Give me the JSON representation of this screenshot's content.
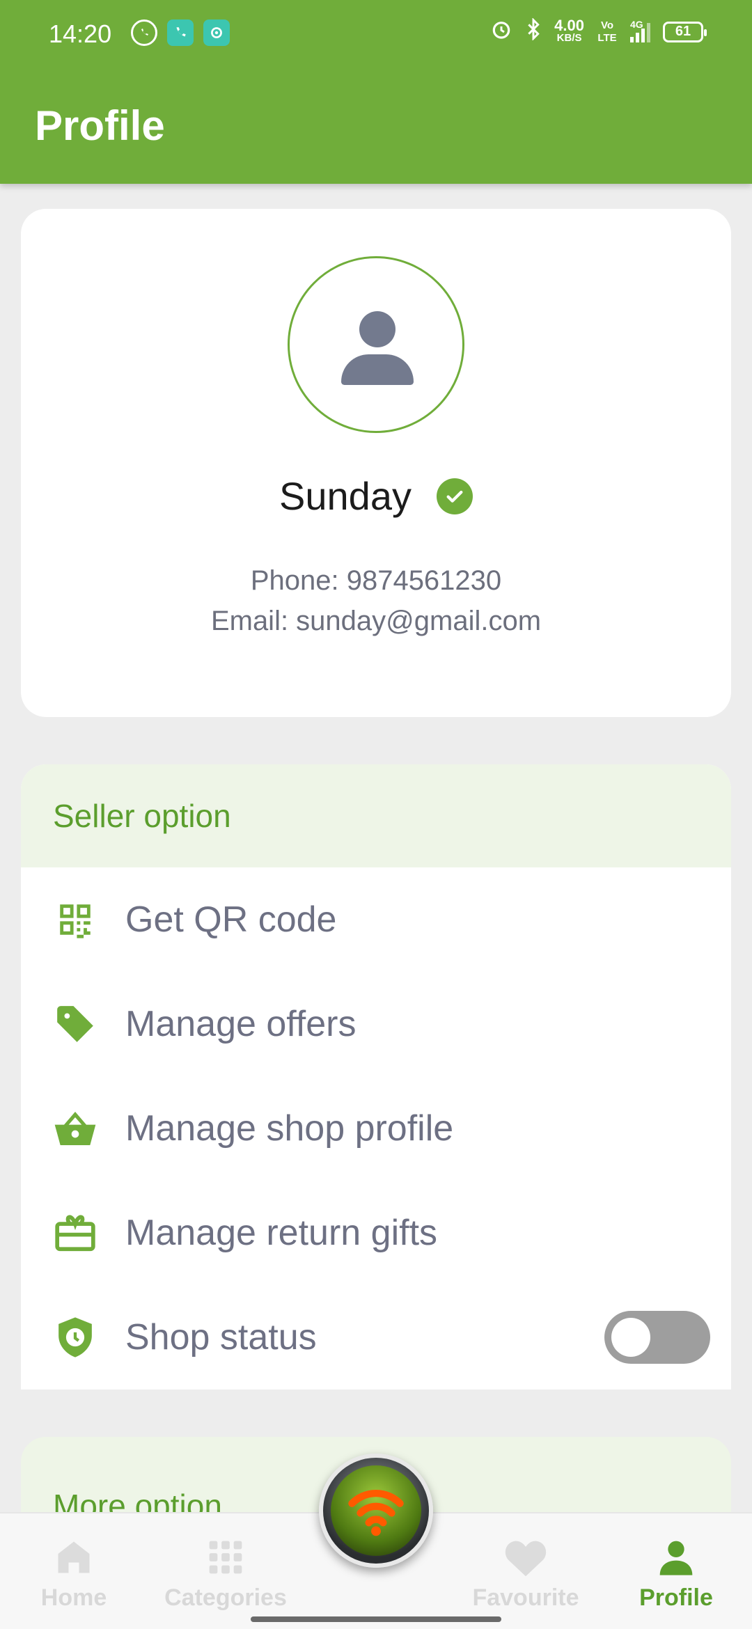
{
  "status_bar": {
    "time": "14:20",
    "net_speed_value": "4.00",
    "net_speed_unit": "KB/S",
    "volte": "Vo LTE",
    "network": "4G",
    "battery": "61"
  },
  "header": {
    "title": "Profile"
  },
  "profile": {
    "name": "Sunday",
    "phone": "Phone: 9874561230",
    "email": "Email: sunday@gmail.com",
    "verified": true
  },
  "seller_section": {
    "title": "Seller option",
    "items": [
      {
        "label": "Get QR code",
        "icon": "qr-code-icon"
      },
      {
        "label": "Manage offers",
        "icon": "tag-icon"
      },
      {
        "label": "Manage shop profile",
        "icon": "basket-icon"
      },
      {
        "label": "Manage return gifts",
        "icon": "gift-card-icon"
      },
      {
        "label": "Shop status",
        "icon": "shield-clock-icon",
        "toggle_on": false
      }
    ]
  },
  "more_section": {
    "title": "More option"
  },
  "bottom_nav": {
    "items": [
      {
        "label": "Home",
        "icon": "home-icon",
        "active": false
      },
      {
        "label": "Categories",
        "icon": "grid-icon",
        "active": false
      },
      {
        "label": "Favourite",
        "icon": "heart-icon",
        "active": false
      },
      {
        "label": "Profile",
        "icon": "person-icon",
        "active": true
      }
    ]
  },
  "colors": {
    "primary": "#70ad3a",
    "section_bg": "#eef5e7",
    "text_muted": "#6d7083",
    "toggle_off": "#9e9e9e"
  }
}
